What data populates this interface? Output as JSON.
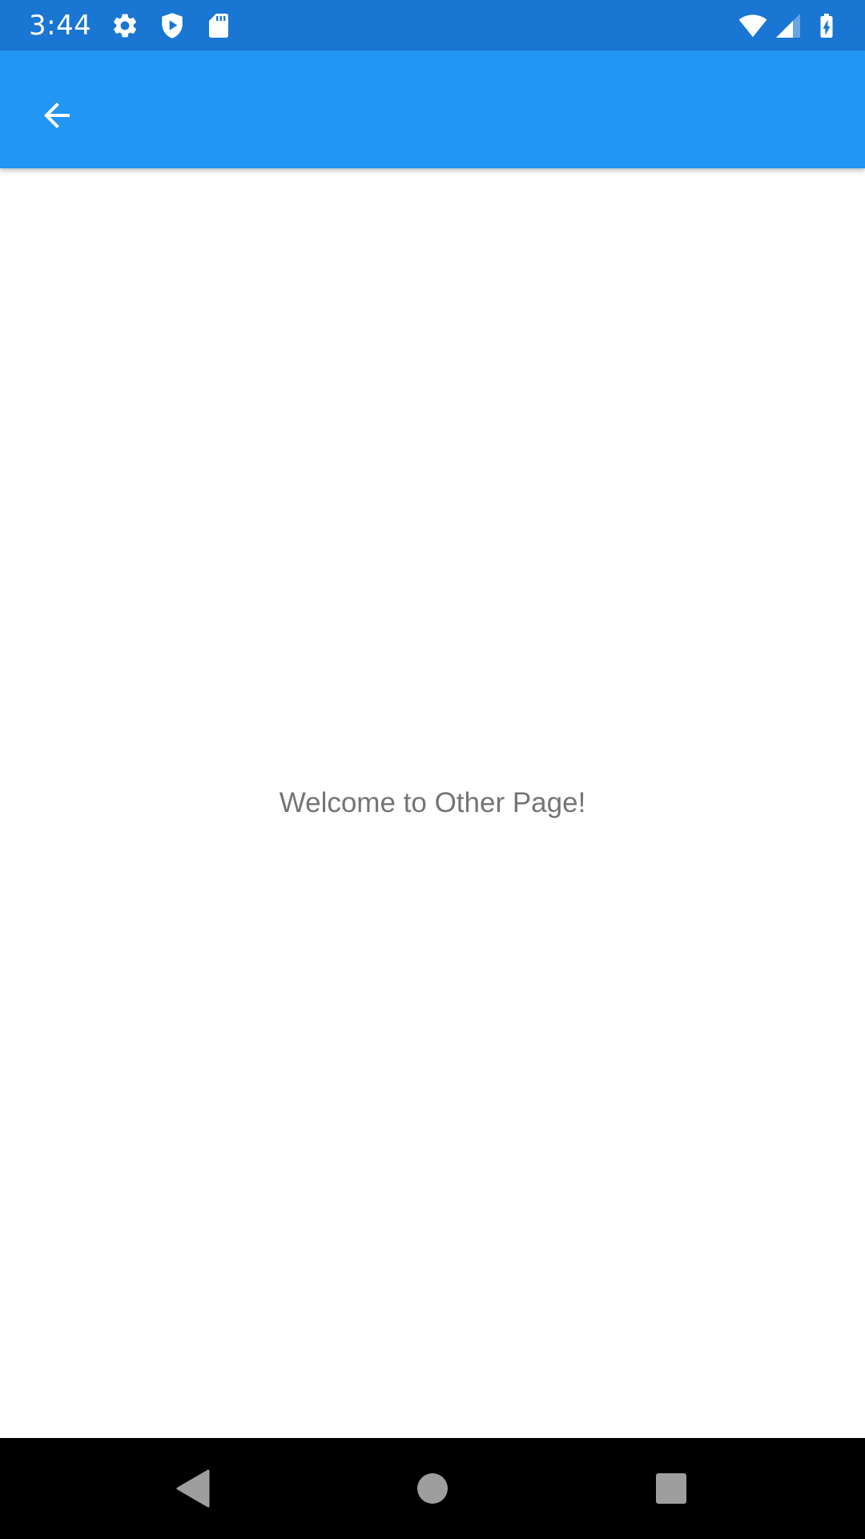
{
  "status_bar": {
    "time": "3:44",
    "background_color": "#1976D2",
    "left_icons": [
      "gear-icon",
      "play-shield-icon",
      "sd-card-icon"
    ],
    "right_icons": [
      "wifi-icon",
      "cell-signal-icon",
      "battery-charging-icon"
    ]
  },
  "app_bar": {
    "background_color": "#2196F3",
    "back_icon": "arrow-back-icon"
  },
  "main": {
    "welcome_text": "Welcome to Other Page!",
    "text_color": "#757575"
  },
  "nav_bar": {
    "background_color": "#000000",
    "buttons": [
      "back-triangle-icon",
      "home-circle-icon",
      "recents-square-icon"
    ]
  }
}
